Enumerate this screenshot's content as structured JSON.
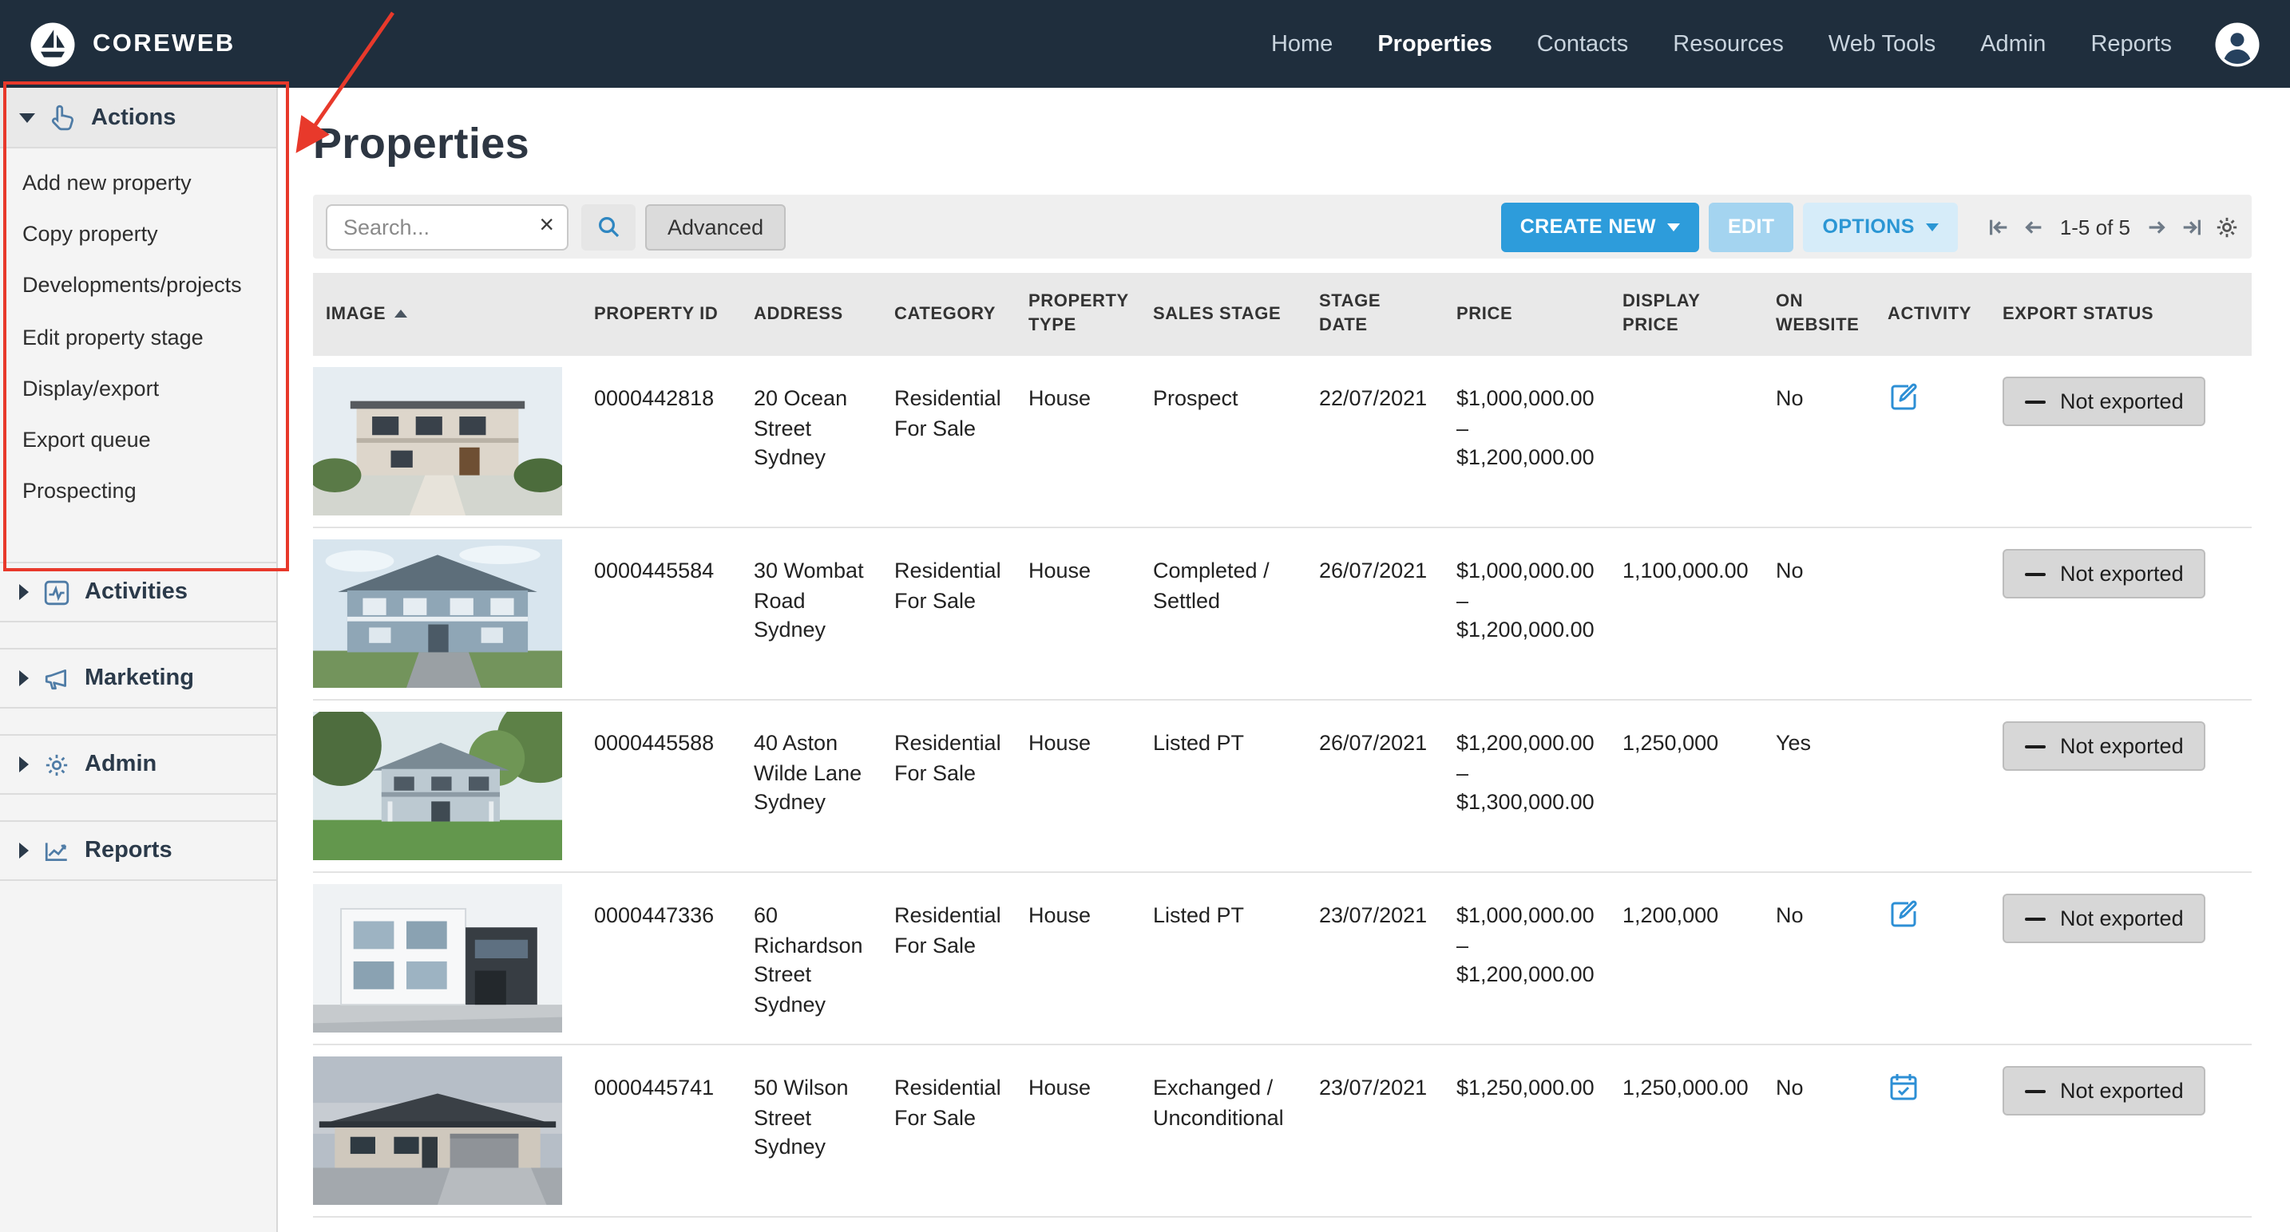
{
  "brand": {
    "name": "COREWEB"
  },
  "topnav": {
    "items": [
      {
        "label": "Home",
        "active": false
      },
      {
        "label": "Properties",
        "active": true
      },
      {
        "label": "Contacts",
        "active": false
      },
      {
        "label": "Resources",
        "active": false
      },
      {
        "label": "Web Tools",
        "active": false
      },
      {
        "label": "Admin",
        "active": false
      },
      {
        "label": "Reports",
        "active": false
      }
    ]
  },
  "sidebar": {
    "sections": [
      {
        "label": "Actions",
        "expanded": true,
        "icon": "hand-pointer-icon",
        "items": [
          "Add new property",
          "Copy property",
          "Developments/projects",
          "Edit property stage",
          "Display/export",
          "Export queue",
          "Prospecting"
        ]
      },
      {
        "label": "Activities",
        "expanded": false,
        "icon": "activity-icon"
      },
      {
        "label": "Marketing",
        "expanded": false,
        "icon": "megaphone-icon"
      },
      {
        "label": "Admin",
        "expanded": false,
        "icon": "gear-icon"
      },
      {
        "label": "Reports",
        "expanded": false,
        "icon": "chart-icon"
      }
    ]
  },
  "main": {
    "title": "Properties",
    "toolbar": {
      "search_placeholder": "Search...",
      "clear_icon": "×",
      "advanced_label": "Advanced",
      "create_new_label": "CREATE NEW",
      "edit_label": "EDIT",
      "options_label": "OPTIONS",
      "pagination_label": "1-5 of 5"
    },
    "table": {
      "columns": [
        "IMAGE",
        "PROPERTY ID",
        "ADDRESS",
        "CATEGORY",
        "PROPERTY TYPE",
        "SALES STAGE",
        "STAGE DATE",
        "PRICE",
        "DISPLAY PRICE",
        "ON WEBSITE",
        "ACTIVITY",
        "EXPORT STATUS"
      ],
      "sorted_column": "IMAGE",
      "sort_direction": "asc",
      "rows": [
        {
          "image_alt": "Modern double-storey house",
          "property_id": "0000442818",
          "address": "20 Ocean Street Sydney",
          "category": "Residential For Sale",
          "property_type": "House",
          "sales_stage": "Prospect",
          "stage_date": "22/07/2021",
          "price": "$1,000,000.00 – $1,200,000.00",
          "display_price": "",
          "on_website": "No",
          "activity": "edit",
          "export_status": "Not exported"
        },
        {
          "image_alt": "Two-storey weatherboard house",
          "property_id": "0000445584",
          "address": "30 Wombat Road Sydney",
          "category": "Residential For Sale",
          "property_type": "House",
          "sales_stage": "Completed / Settled",
          "stage_date": "26/07/2021",
          "price": "$1,000,000.00 – $1,200,000.00",
          "display_price": "1,100,000.00",
          "on_website": "No",
          "activity": "",
          "export_status": "Not exported"
        },
        {
          "image_alt": "House surrounded by trees",
          "property_id": "0000445588",
          "address": "40 Aston Wilde Lane Sydney",
          "category": "Residential For Sale",
          "property_type": "House",
          "sales_stage": "Listed PT",
          "stage_date": "26/07/2021",
          "price": "$1,200,000.00 – $1,300,000.00",
          "display_price": "1,250,000",
          "on_website": "Yes",
          "activity": "",
          "export_status": "Not exported"
        },
        {
          "image_alt": "Modern white and dark house",
          "property_id": "0000447336",
          "address": "60 Richardson Street Sydney",
          "category": "Residential For Sale",
          "property_type": "House",
          "sales_stage": "Listed PT",
          "stage_date": "23/07/2021",
          "price": "$1,000,000.00 – $1,200,000.00",
          "display_price": "1,200,000",
          "on_website": "No",
          "activity": "edit",
          "export_status": "Not exported"
        },
        {
          "image_alt": "Single-storey house at dusk",
          "property_id": "0000445741",
          "address": "50 Wilson Street Sydney",
          "category": "Residential For Sale",
          "property_type": "House",
          "sales_stage": "Exchanged / Unconditional",
          "stage_date": "23/07/2021",
          "price": "$1,250,000.00",
          "display_price": "1,250,000.00",
          "on_website": "No",
          "activity": "calendar",
          "export_status": "Not exported"
        }
      ]
    }
  },
  "annotation": {
    "color": "#e8392b",
    "highlight": "Actions menu"
  },
  "colors": {
    "topnav_bg": "#1f2e3d",
    "accent_blue": "#2d9cdb",
    "icon_blue": "#2d8fd5"
  }
}
